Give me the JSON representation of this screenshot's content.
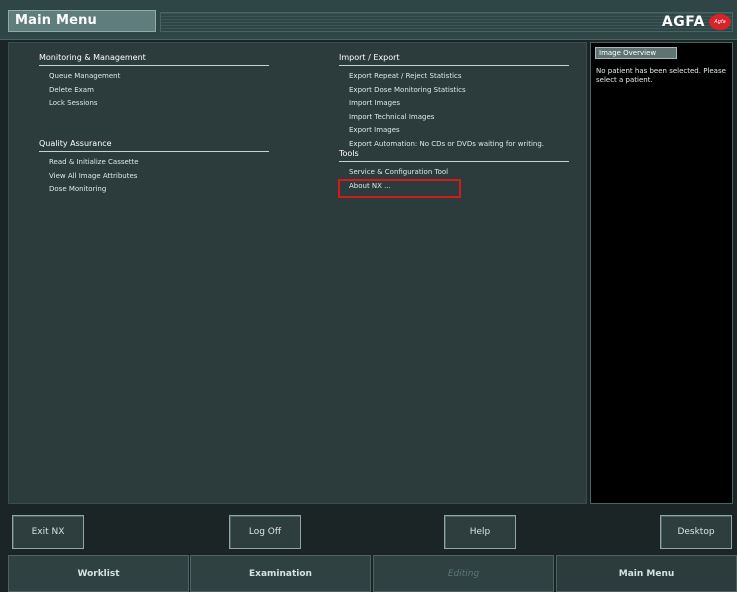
{
  "header": {
    "title": "Main Menu",
    "logo_text": "AGFA",
    "logo_mark": "Agfa",
    "brand_color": "#d8232a"
  },
  "sections": {
    "monitoring": {
      "title": "Monitoring & Management",
      "items": [
        "Queue Management",
        "Delete Exam",
        "Lock Sessions"
      ]
    },
    "quality": {
      "title": "Quality Assurance",
      "items": [
        "Read & Initialize Cassette",
        "View All Image Attributes",
        "Dose Monitoring"
      ]
    },
    "import_export": {
      "title": "Import / Export",
      "items": [
        "Export Repeat / Reject Statistics",
        "Export Dose Monitoring Statistics",
        "Import Images",
        "Import Technical Images",
        "Export Images",
        "Export Automation: No CDs or DVDs waiting for writing."
      ]
    },
    "tools": {
      "title": "Tools",
      "items": [
        "Service & Configuration Tool",
        "About NX ..."
      ]
    }
  },
  "highlighted_item": "About NX ...",
  "image_overview": {
    "tab_label": "Image Overview",
    "message": "No patient has been selected. Please select a patient."
  },
  "buttons": {
    "exit": "Exit NX",
    "logoff": "Log Off",
    "help": "Help",
    "desktop": "Desktop"
  },
  "tabs": [
    {
      "label": "Worklist",
      "state": "normal"
    },
    {
      "label": "Examination",
      "state": "normal"
    },
    {
      "label": "Editing",
      "state": "disabled"
    },
    {
      "label": "Main Menu",
      "state": "active"
    }
  ]
}
